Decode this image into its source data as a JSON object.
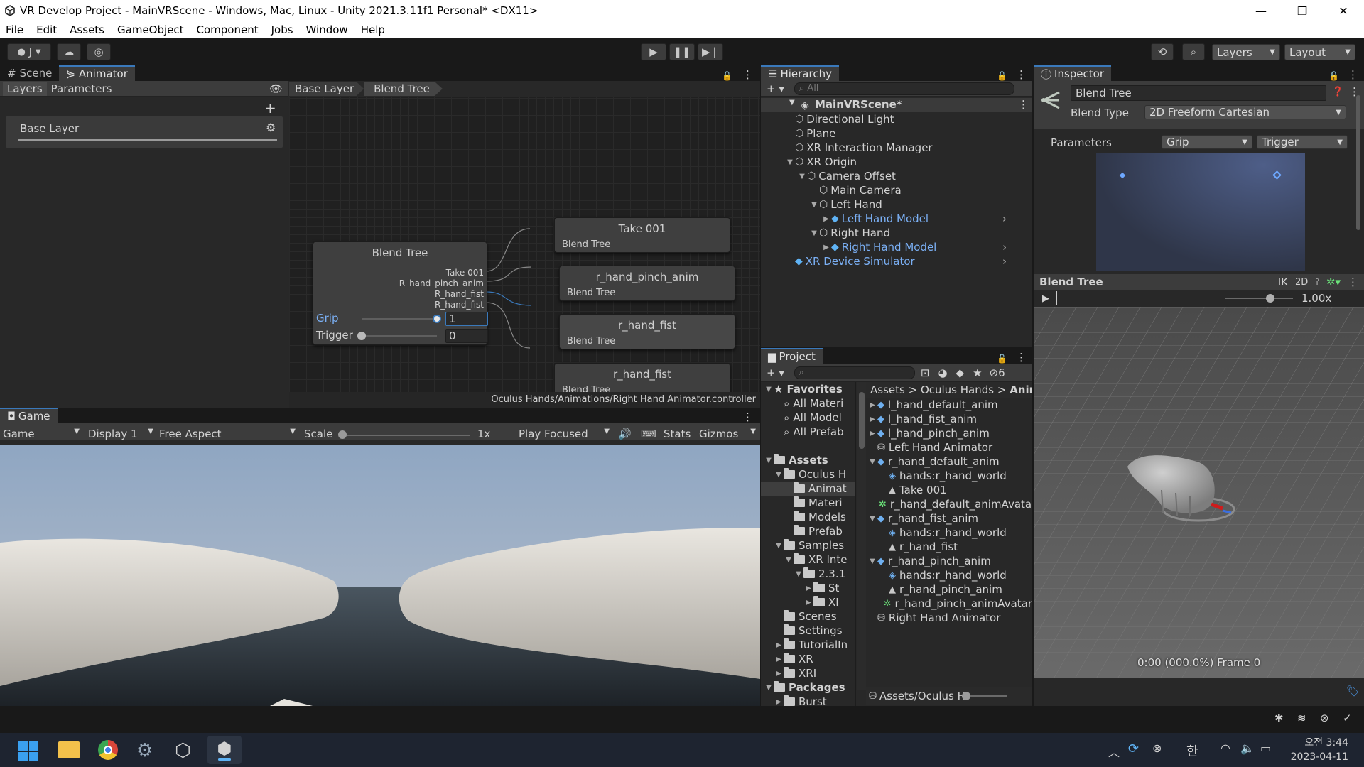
{
  "window": {
    "title": "VR Develop Project - MainVRScene - Windows, Mac, Linux - Unity 2021.3.11f1 Personal* <DX11>"
  },
  "menu": [
    "File",
    "Edit",
    "Assets",
    "GameObject",
    "Component",
    "Jobs",
    "Window",
    "Help"
  ],
  "toolbar": {
    "account": "J",
    "layers": "Layers",
    "layout": "Layout"
  },
  "animator": {
    "tabs": [
      "Scene",
      "Animator"
    ],
    "left_tabs": [
      "Layers",
      "Parameters"
    ],
    "layer": "Base Layer",
    "breadcrumb": [
      "Base Layer",
      "Blend Tree"
    ],
    "footer": "Oculus Hands/Animations/Right Hand Animator.controller",
    "blend_node": {
      "title": "Blend Tree",
      "outputs": [
        "Take 001",
        "R_hand_pinch_anim",
        "R_hand_fist",
        "R_hand_fist"
      ],
      "params": [
        {
          "name": "Grip",
          "value": "1",
          "level": 1
        },
        {
          "name": "Trigger",
          "value": "0",
          "level": 0
        }
      ]
    },
    "motion_nodes": [
      {
        "title": "Take 001",
        "label": "Blend Tree"
      },
      {
        "title": "r_hand_pinch_anim",
        "label": "Blend Tree"
      },
      {
        "title": "r_hand_fist",
        "label": "Blend Tree"
      },
      {
        "title": "r_hand_fist",
        "label": "Blend Tree"
      }
    ]
  },
  "game": {
    "tab": "Game",
    "view": "Game",
    "display": "Display 1",
    "aspect": "Free Aspect",
    "scale_label": "Scale",
    "scale_value": "1x",
    "play_mode": "Play Focused",
    "stats": "Stats",
    "gizmos": "Gizmos"
  },
  "hierarchy": {
    "tab": "Hierarchy",
    "search": "All",
    "scene": "MainVRScene*",
    "items": [
      {
        "label": "Directional Light",
        "depth": 1,
        "arrow": "",
        "blue": false
      },
      {
        "label": "Plane",
        "depth": 1,
        "arrow": "",
        "blue": false
      },
      {
        "label": "XR Interaction Manager",
        "depth": 1,
        "arrow": "",
        "blue": false
      },
      {
        "label": "XR Origin",
        "depth": 1,
        "arrow": "▼",
        "blue": false
      },
      {
        "label": "Camera Offset",
        "depth": 2,
        "arrow": "▼",
        "blue": false
      },
      {
        "label": "Main Camera",
        "depth": 3,
        "arrow": "",
        "blue": false
      },
      {
        "label": "Left Hand",
        "depth": 3,
        "arrow": "▼",
        "blue": false
      },
      {
        "label": "Left Hand Model",
        "depth": 4,
        "arrow": "▶",
        "blue": true
      },
      {
        "label": "Right Hand",
        "depth": 3,
        "arrow": "▼",
        "blue": false
      },
      {
        "label": "Right Hand Model",
        "depth": 4,
        "arrow": "▶",
        "blue": true
      },
      {
        "label": "XR Device Simulator",
        "depth": 1,
        "arrow": "",
        "blue": true
      }
    ]
  },
  "project": {
    "tab": "Project",
    "hidden_count": "6",
    "breadcrumb": [
      "Assets",
      "Oculus Hands",
      "Anima"
    ],
    "tree": [
      {
        "label": "Favorites",
        "depth": 0,
        "arrow": "▼",
        "kind": "star",
        "bold": true
      },
      {
        "label": "All Materi",
        "depth": 1,
        "arrow": "",
        "kind": "search",
        "bold": false
      },
      {
        "label": "All Model",
        "depth": 1,
        "arrow": "",
        "kind": "search",
        "bold": false
      },
      {
        "label": "All Prefab",
        "depth": 1,
        "arrow": "",
        "kind": "search",
        "bold": false
      },
      {
        "label": "",
        "depth": 0,
        "arrow": "",
        "kind": "none",
        "bold": false
      },
      {
        "label": "Assets",
        "depth": 0,
        "arrow": "▼",
        "kind": "folder",
        "bold": true
      },
      {
        "label": "Oculus H",
        "depth": 1,
        "arrow": "▼",
        "kind": "folder",
        "bold": false
      },
      {
        "label": "Animat",
        "depth": 2,
        "arrow": "",
        "kind": "folder",
        "bold": false,
        "sel": true
      },
      {
        "label": "Materi",
        "depth": 2,
        "arrow": "",
        "kind": "folder",
        "bold": false
      },
      {
        "label": "Models",
        "depth": 2,
        "arrow": "",
        "kind": "folder",
        "bold": false
      },
      {
        "label": "Prefab",
        "depth": 2,
        "arrow": "",
        "kind": "folder",
        "bold": false
      },
      {
        "label": "Samples",
        "depth": 1,
        "arrow": "▼",
        "kind": "folder",
        "bold": false
      },
      {
        "label": "XR Inte",
        "depth": 2,
        "arrow": "▼",
        "kind": "folder",
        "bold": false
      },
      {
        "label": "2.3.1",
        "depth": 3,
        "arrow": "▼",
        "kind": "folder",
        "bold": false
      },
      {
        "label": "St",
        "depth": 4,
        "arrow": "▶",
        "kind": "folder",
        "bold": false
      },
      {
        "label": "XI",
        "depth": 4,
        "arrow": "▶",
        "kind": "folder",
        "bold": false
      },
      {
        "label": "Scenes",
        "depth": 1,
        "arrow": "",
        "kind": "folder",
        "bold": false
      },
      {
        "label": "Settings",
        "depth": 1,
        "arrow": "",
        "kind": "folder",
        "bold": false
      },
      {
        "label": "TutorialIn",
        "depth": 1,
        "arrow": "▶",
        "kind": "folder",
        "bold": false
      },
      {
        "label": "XR",
        "depth": 1,
        "arrow": "▶",
        "kind": "folder",
        "bold": false
      },
      {
        "label": "XRI",
        "depth": 1,
        "arrow": "▶",
        "kind": "folder",
        "bold": false
      },
      {
        "label": "Packages",
        "depth": 0,
        "arrow": "▼",
        "kind": "folder",
        "bold": true
      },
      {
        "label": "Burst",
        "depth": 1,
        "arrow": "▶",
        "kind": "folder",
        "bold": false
      }
    ],
    "assets": [
      {
        "label": "l_hand_default_anim",
        "depth": 0,
        "arrow": "▶",
        "kind": "model"
      },
      {
        "label": "l_hand_fist_anim",
        "depth": 0,
        "arrow": "▶",
        "kind": "model"
      },
      {
        "label": "l_hand_pinch_anim",
        "depth": 0,
        "arrow": "▶",
        "kind": "model"
      },
      {
        "label": "Left Hand Animator",
        "depth": 0,
        "arrow": "",
        "kind": "animator"
      },
      {
        "label": "r_hand_default_anim",
        "depth": 0,
        "arrow": "▼",
        "kind": "model"
      },
      {
        "label": "hands:r_hand_world",
        "depth": 1,
        "arrow": "",
        "kind": "mesh"
      },
      {
        "label": "Take 001",
        "depth": 1,
        "arrow": "",
        "kind": "clip"
      },
      {
        "label": "r_hand_default_animAvatar",
        "depth": 1,
        "arrow": "",
        "kind": "avatar"
      },
      {
        "label": "r_hand_fist_anim",
        "depth": 0,
        "arrow": "▼",
        "kind": "model"
      },
      {
        "label": "hands:r_hand_world",
        "depth": 1,
        "arrow": "",
        "kind": "mesh"
      },
      {
        "label": "r_hand_fist",
        "depth": 1,
        "arrow": "",
        "kind": "clip"
      },
      {
        "label": "r_hand_pinch_anim",
        "depth": 0,
        "arrow": "▼",
        "kind": "model"
      },
      {
        "label": "hands:r_hand_world",
        "depth": 1,
        "arrow": "",
        "kind": "mesh"
      },
      {
        "label": "r_hand_pinch_anim",
        "depth": 1,
        "arrow": "",
        "kind": "clip"
      },
      {
        "label": "r_hand_pinch_animAvatar",
        "depth": 1,
        "arrow": "",
        "kind": "avatar"
      },
      {
        "label": "Right Hand Animator",
        "depth": 0,
        "arrow": "",
        "kind": "animator"
      }
    ],
    "footer_path": "Assets/Oculus Ha"
  },
  "inspector": {
    "tab": "Inspector",
    "name": "Blend Tree",
    "blend_type_label": "Blend Type",
    "blend_type": "2D Freeform Cartesian",
    "params_label": "Parameters",
    "param_x": "Grip",
    "param_y": "Trigger",
    "preview_title": "Blend Tree",
    "ik": "IK",
    "mode_2d": "2D",
    "speed": "1.00x",
    "status": "0:00 (000.0%) Frame 0"
  },
  "taskbar": {
    "time": "오전 3:44",
    "date": "2023-04-11",
    "ime": "한"
  }
}
